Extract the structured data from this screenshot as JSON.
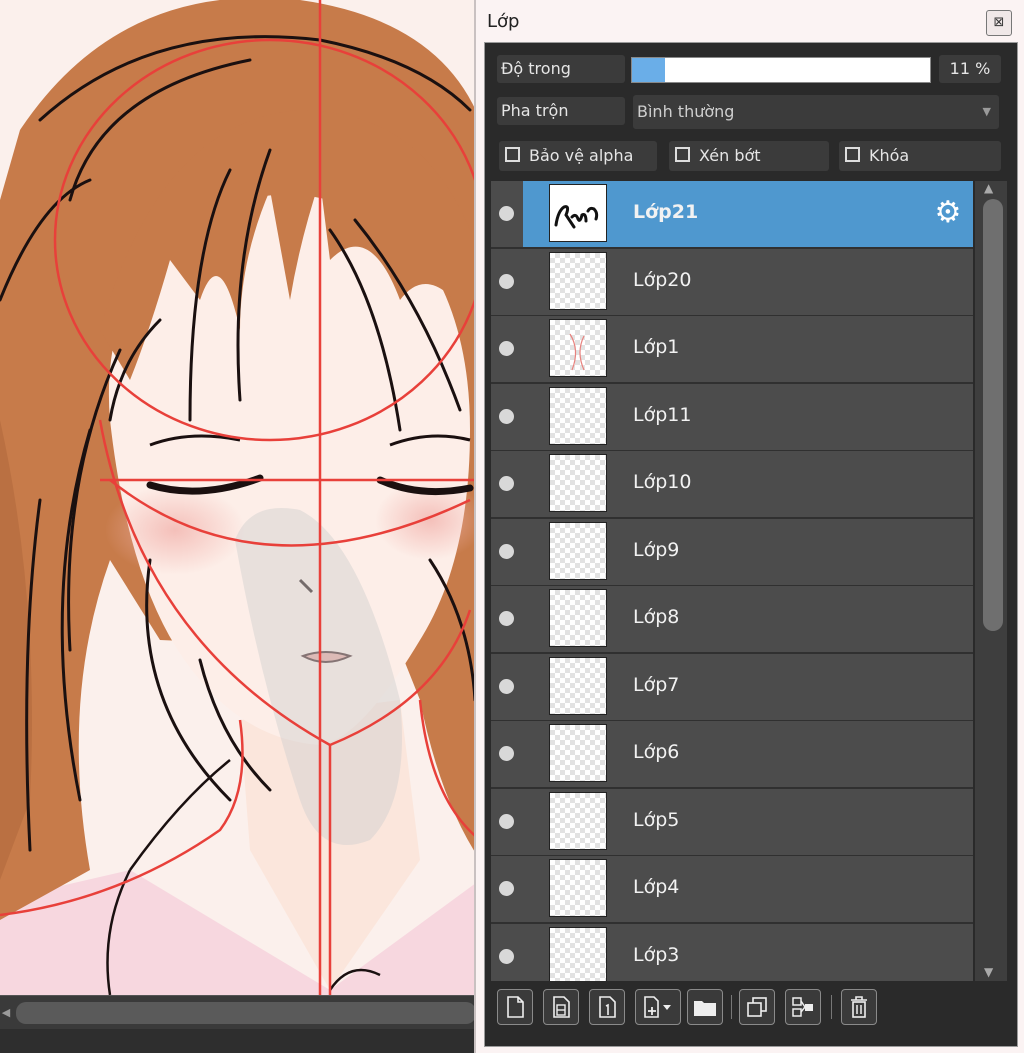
{
  "panel": {
    "title": "Lớp",
    "close_icon": "close-icon"
  },
  "opacity": {
    "label": "Độ trong",
    "value": "11 %",
    "fraction": 0.11
  },
  "blend": {
    "label": "Pha trộn",
    "selected": "Bình thường"
  },
  "options": {
    "protect_alpha": "Bảo vệ alpha",
    "clipping": "Xén bớt",
    "lock": "Khóa"
  },
  "layers": [
    {
      "name": "Lớp21",
      "selected": true
    },
    {
      "name": "Lớp20",
      "selected": false
    },
    {
      "name": "Lớp1",
      "selected": false
    },
    {
      "name": "Lớp11",
      "selected": false
    },
    {
      "name": "Lớp10",
      "selected": false
    },
    {
      "name": "Lớp9",
      "selected": false
    },
    {
      "name": "Lớp8",
      "selected": false
    },
    {
      "name": "Lớp7",
      "selected": false
    },
    {
      "name": "Lớp6",
      "selected": false
    },
    {
      "name": "Lớp5",
      "selected": false
    },
    {
      "name": "Lớp4",
      "selected": false
    },
    {
      "name": "Lớp3",
      "selected": false
    }
  ],
  "toolbar_icons": [
    "new-layer-icon",
    "new-8bit-layer-icon",
    "new-1bit-layer-icon",
    "add-layer-menu-icon",
    "new-folder-icon",
    "duplicate-layer-icon",
    "merge-down-icon",
    "delete-layer-icon"
  ],
  "colors": {
    "accent": "#4f98cf",
    "slider_fill": "#6aaee8",
    "panel_bg": "#2a2a2a"
  }
}
